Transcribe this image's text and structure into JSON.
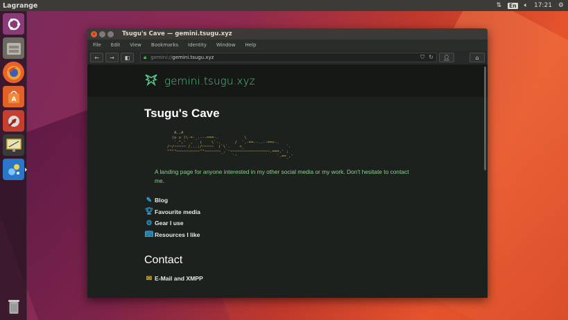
{
  "top_panel": {
    "app_name": "Lagrange",
    "lang": "En",
    "time": "17:21"
  },
  "window": {
    "title": "Tsugu's Cave — gemini.tsugu.xyz",
    "menu": [
      "File",
      "Edit",
      "View",
      "Bookmarks",
      "Identity",
      "Window",
      "Help"
    ],
    "url_proto": "gemini://",
    "url_host": "gemini.tsugu.xyz"
  },
  "banner": {
    "site_name": "gemini.tsugu.xyz"
  },
  "page": {
    "title": "Tsugu's Cave",
    "ascii_art": "        A.,A\n       (u u )\\-=-_.---===-.           \\\n        `.^,'  ,   (    \\`-.      /  `.-==--..--==>-.\n     /~/~~~~~ /...;/~~~~~  (`\\`.    <_                  `.\n     \"\"\"\"~~~~~~~~~~\"\"~~~~~~~_,`'~~~~~~~~~~~~~~~~~.===,' ;\n                                 `'                 `.==_,'",
    "intro": "A landing page for anyone interested in my other social media or my work. Don't hesitate to contact me.",
    "links": [
      {
        "label": "Blog",
        "icon": "notebook-icon"
      },
      {
        "label": "Favourite media",
        "icon": "trophy-icon"
      },
      {
        "label": "Gear I use",
        "icon": "gear-icon"
      },
      {
        "label": "Resources I like",
        "icon": "book-icon"
      }
    ],
    "contact_heading": "Contact",
    "contact_link": "E-Mail and XMPP"
  },
  "colors": {
    "accent_green": "#53c98a",
    "intro_green": "#8fcf8f",
    "link_icon_blue": "#2a9fd6",
    "ascii_gold": "#c9a95c",
    "contact_icon_yellow": "#e6b320"
  }
}
